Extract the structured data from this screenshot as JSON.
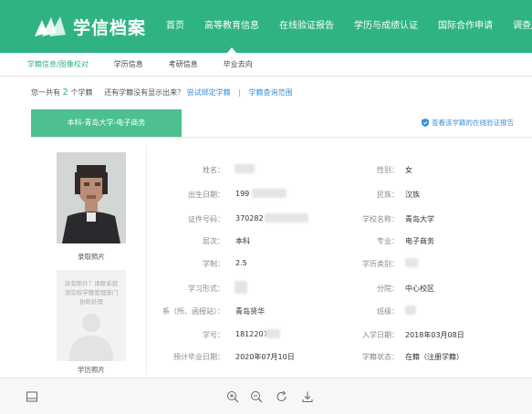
{
  "header": {
    "logo_text": "学信档案",
    "nav": [
      {
        "label": "首页"
      },
      {
        "label": "高等教育信息"
      },
      {
        "label": "在线验证报告"
      },
      {
        "label": "学历与成绩认证"
      },
      {
        "label": "国际合作申请"
      },
      {
        "label": "调查/投"
      }
    ],
    "active_nav": 1
  },
  "subnav": {
    "items": [
      {
        "label": "学籍信息/图像校对"
      },
      {
        "label": "学历信息"
      },
      {
        "label": "考研信息"
      },
      {
        "label": "毕业去向"
      }
    ],
    "active_index": 0
  },
  "summary": {
    "prefix": "您一共有",
    "count": "2",
    "suffix": "个学籍",
    "question": "还有学籍没有显示出来？",
    "link1": "尝试绑定学籍",
    "separator": "|",
    "link2": "学籍查询范围"
  },
  "record": {
    "tab_label": "本科-青岛大学-电子商务",
    "verify_link": "查看该学籍的在线验证报告",
    "photo1_caption": "录取照片",
    "photo2_text": "没有照片？请联系就读院校学籍管理部门协助处理",
    "photo2_caption": "学历照片",
    "fields_left": [
      {
        "label": "姓名：",
        "value": ""
      },
      {
        "label": "出生日期：",
        "value": "199"
      },
      {
        "label": "证件号码：",
        "value": "370282"
      },
      {
        "label": "层次：",
        "value": "本科"
      },
      {
        "label": "学制：",
        "value": "2.5"
      },
      {
        "label": "学习形式：",
        "value": ""
      },
      {
        "label": "系（所、函授站）：",
        "value": "青岛贤华"
      },
      {
        "label": "学号：",
        "value": "1812207"
      },
      {
        "label": "预计毕业日期：",
        "value": "2020年07月10日"
      }
    ],
    "fields_right": [
      {
        "label": "性别：",
        "value": "女"
      },
      {
        "label": "民族：",
        "value": "汉族"
      },
      {
        "label": "学校名称：",
        "value": "青岛大学"
      },
      {
        "label": "专业：",
        "value": "电子商务"
      },
      {
        "label": "学历类别：",
        "value": ""
      },
      {
        "label": "分院：",
        "value": "中心校区"
      },
      {
        "label": "班级：",
        "value": ""
      },
      {
        "label": "入学日期：",
        "value": "2018年03月08日"
      },
      {
        "label": "学籍状态：",
        "value": "在籍（注册学籍）"
      }
    ]
  },
  "footer": {
    "icons": [
      "save-icon",
      "zoom-in-icon",
      "zoom-out-icon",
      "rotate-icon",
      "download-icon"
    ]
  },
  "colors": {
    "brand": "#2fb383",
    "tab": "#4cc08f",
    "link": "#3b8fd6"
  }
}
